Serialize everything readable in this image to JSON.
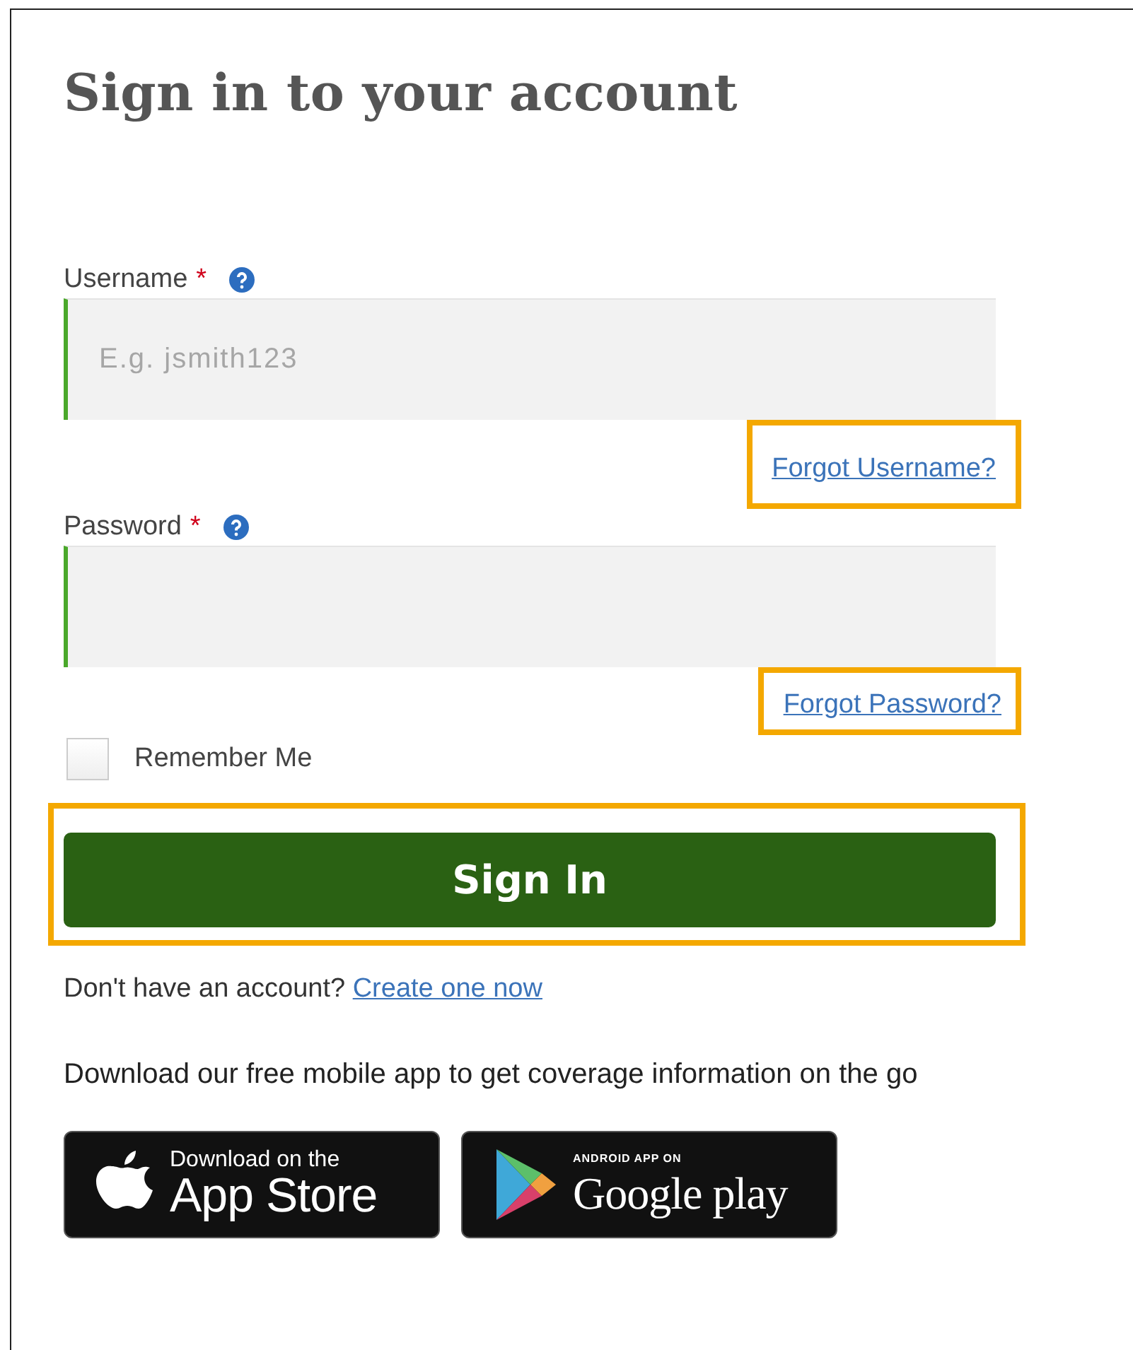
{
  "title": "Sign in to your account",
  "fields": [
    {
      "label": "Username",
      "required_mark": "*",
      "placeholder": "E.g. jsmith123",
      "link": {
        "text": "Forgot Username?",
        "highlighted": true
      }
    },
    {
      "label": "Password",
      "required_mark": "*",
      "link": {
        "text": "Forgot Password?",
        "highlighted": true
      }
    }
  ],
  "remember": {
    "label": "Remember Me",
    "checked": false
  },
  "sign_in": {
    "label": "Sign In",
    "highlighted": true
  },
  "signup": {
    "text": "Don't have an account?",
    "link": "Create one now"
  },
  "app_note": "Download our free mobile app to get coverage information on the go",
  "badges": [
    {
      "kind": "apple",
      "small": "Download on the",
      "big": "App Store"
    },
    {
      "kind": "google",
      "small": "ANDROID APP ON",
      "big": "Google play"
    }
  ]
}
